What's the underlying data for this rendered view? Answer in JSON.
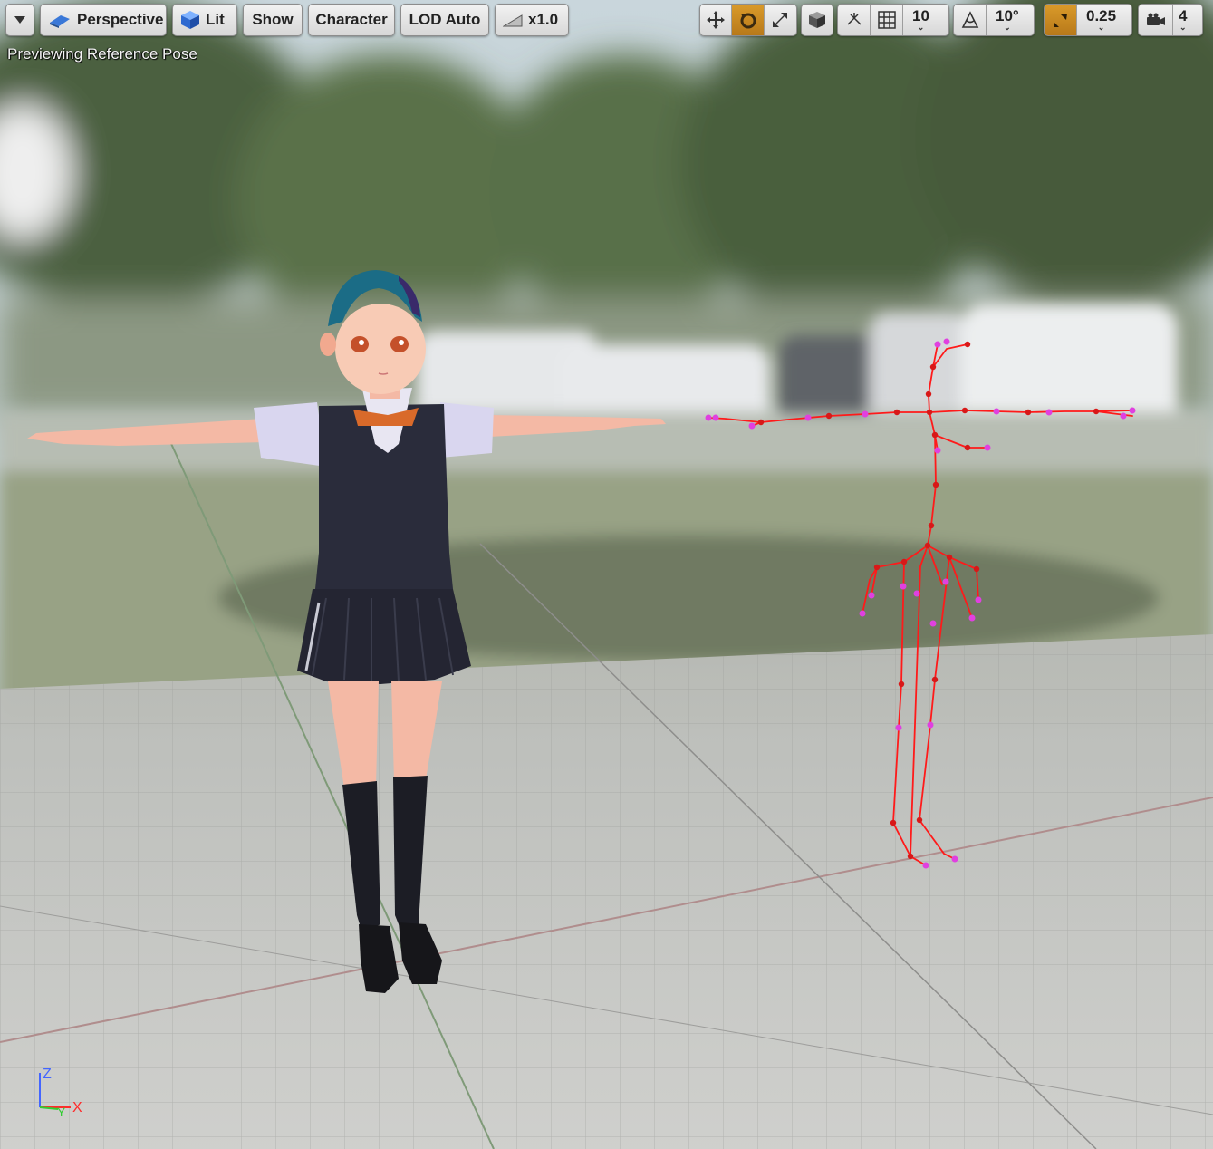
{
  "toolbar": {
    "menu_icon": "chevron-down-icon",
    "perspective_label": "Perspective",
    "lit_label": "Lit",
    "show_label": "Show",
    "character_label": "Character",
    "lod_label": "LOD Auto",
    "speed_label": "x1.0",
    "grid_snap_value": "10",
    "rotation_snap_value": "10°",
    "scale_snap_value": "0.25",
    "camera_speed_value": "4"
  },
  "viewport": {
    "status_text": "Previewing Reference Pose",
    "axis": {
      "z": "Z",
      "y": "Y",
      "x": "X"
    }
  },
  "colors": {
    "accent": "#c88a22",
    "bone": "#ff1a1a",
    "joint": "#e040e0"
  }
}
